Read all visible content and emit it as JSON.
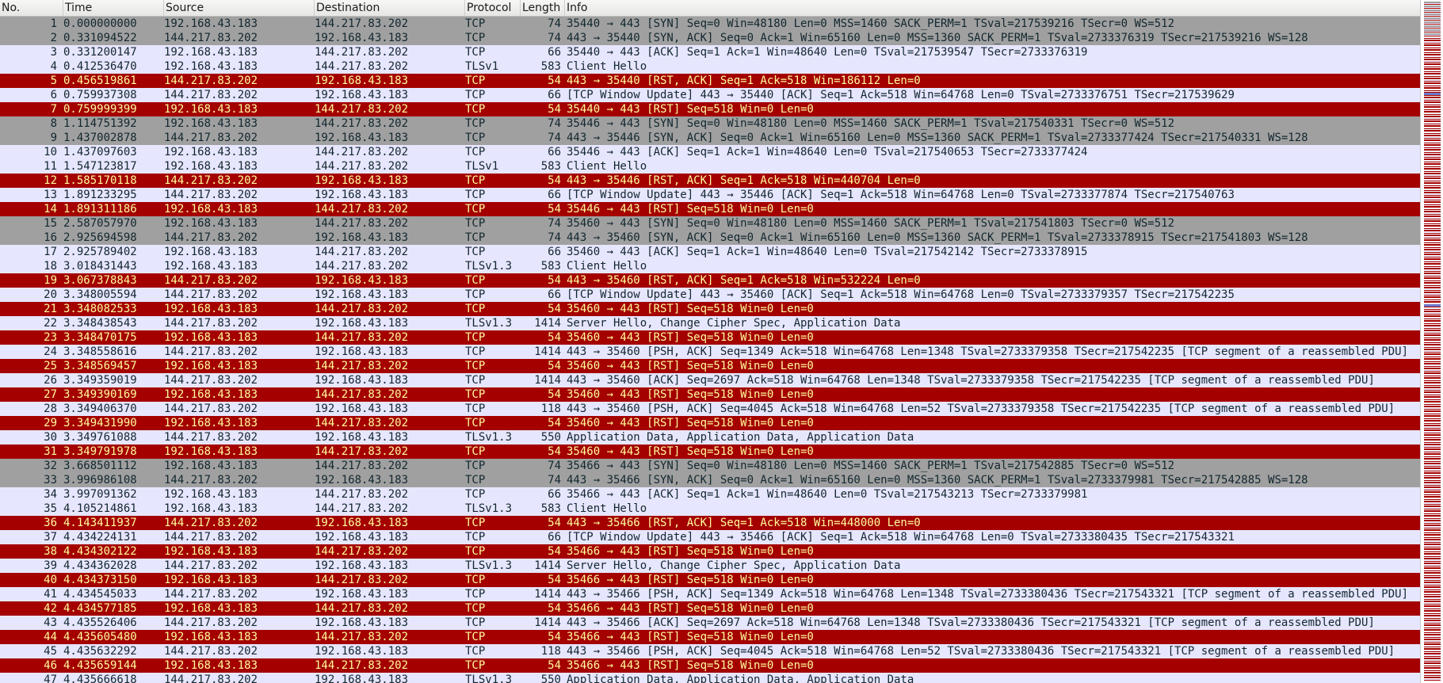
{
  "columns": {
    "no": "No.",
    "time": "Time",
    "source": "Source",
    "destination": "Destination",
    "protocol": "Protocol",
    "length": "Length",
    "info": "Info"
  },
  "colors": {
    "syn_bg": "#a0a0a0",
    "tcp_bg": "#e7e6ff",
    "rst_bg": "#a40000",
    "rst_fg": "#fffc9c",
    "text": "#12272e"
  },
  "packets": [
    {
      "no": "1",
      "time": "0.000000000",
      "src": "192.168.43.183",
      "dst": "144.217.83.202",
      "proto": "TCP",
      "len": "74",
      "info": "35440 → 443 [SYN] Seq=0 Win=48180 Len=0 MSS=1460 SACK_PERM=1 TSval=217539216 TSecr=0 WS=512",
      "color": "syn"
    },
    {
      "no": "2",
      "time": "0.331094522",
      "src": "144.217.83.202",
      "dst": "192.168.43.183",
      "proto": "TCP",
      "len": "74",
      "info": "443 → 35440 [SYN, ACK] Seq=0 Ack=1 Win=65160 Len=0 MSS=1360 SACK_PERM=1 TSval=2733376319 TSecr=217539216 WS=128",
      "color": "syn"
    },
    {
      "no": "3",
      "time": "0.331200147",
      "src": "192.168.43.183",
      "dst": "144.217.83.202",
      "proto": "TCP",
      "len": "66",
      "info": "35440 → 443 [ACK] Seq=1 Ack=1 Win=48640 Len=0 TSval=217539547 TSecr=2733376319",
      "color": "tcp"
    },
    {
      "no": "4",
      "time": "0.412536470",
      "src": "192.168.43.183",
      "dst": "144.217.83.202",
      "proto": "TLSv1",
      "len": "583",
      "info": "Client Hello",
      "color": "tcp"
    },
    {
      "no": "5",
      "time": "0.456519861",
      "src": "144.217.83.202",
      "dst": "192.168.43.183",
      "proto": "TCP",
      "len": "54",
      "info": "443 → 35440 [RST, ACK] Seq=1 Ack=518 Win=186112 Len=0",
      "color": "rst"
    },
    {
      "no": "6",
      "time": "0.759937308",
      "src": "144.217.83.202",
      "dst": "192.168.43.183",
      "proto": "TCP",
      "len": "66",
      "info": "[TCP Window Update] 443 → 35440 [ACK] Seq=1 Ack=518 Win=64768 Len=0 TSval=2733376751 TSecr=217539629",
      "color": "tcp"
    },
    {
      "no": "7",
      "time": "0.759999399",
      "src": "192.168.43.183",
      "dst": "144.217.83.202",
      "proto": "TCP",
      "len": "54",
      "info": "35440 → 443 [RST] Seq=518 Win=0 Len=0",
      "color": "rst"
    },
    {
      "no": "8",
      "time": "1.114751392",
      "src": "192.168.43.183",
      "dst": "144.217.83.202",
      "proto": "TCP",
      "len": "74",
      "info": "35446 → 443 [SYN] Seq=0 Win=48180 Len=0 MSS=1460 SACK_PERM=1 TSval=217540331 TSecr=0 WS=512",
      "color": "syn"
    },
    {
      "no": "9",
      "time": "1.437002878",
      "src": "144.217.83.202",
      "dst": "192.168.43.183",
      "proto": "TCP",
      "len": "74",
      "info": "443 → 35446 [SYN, ACK] Seq=0 Ack=1 Win=65160 Len=0 MSS=1360 SACK_PERM=1 TSval=2733377424 TSecr=217540331 WS=128",
      "color": "syn"
    },
    {
      "no": "10",
      "time": "1.437097603",
      "src": "192.168.43.183",
      "dst": "144.217.83.202",
      "proto": "TCP",
      "len": "66",
      "info": "35446 → 443 [ACK] Seq=1 Ack=1 Win=48640 Len=0 TSval=217540653 TSecr=2733377424",
      "color": "tcp"
    },
    {
      "no": "11",
      "time": "1.547123817",
      "src": "192.168.43.183",
      "dst": "144.217.83.202",
      "proto": "TLSv1",
      "len": "583",
      "info": "Client Hello",
      "color": "tcp"
    },
    {
      "no": "12",
      "time": "1.585170118",
      "src": "144.217.83.202",
      "dst": "192.168.43.183",
      "proto": "TCP",
      "len": "54",
      "info": "443 → 35446 [RST, ACK] Seq=1 Ack=518 Win=440704 Len=0",
      "color": "rst"
    },
    {
      "no": "13",
      "time": "1.891233295",
      "src": "144.217.83.202",
      "dst": "192.168.43.183",
      "proto": "TCP",
      "len": "66",
      "info": "[TCP Window Update] 443 → 35446 [ACK] Seq=1 Ack=518 Win=64768 Len=0 TSval=2733377874 TSecr=217540763",
      "color": "tcp"
    },
    {
      "no": "14",
      "time": "1.891311186",
      "src": "192.168.43.183",
      "dst": "144.217.83.202",
      "proto": "TCP",
      "len": "54",
      "info": "35446 → 443 [RST] Seq=518 Win=0 Len=0",
      "color": "rst"
    },
    {
      "no": "15",
      "time": "2.587057970",
      "src": "192.168.43.183",
      "dst": "144.217.83.202",
      "proto": "TCP",
      "len": "74",
      "info": "35460 → 443 [SYN] Seq=0 Win=48180 Len=0 MSS=1460 SACK_PERM=1 TSval=217541803 TSecr=0 WS=512",
      "color": "syn"
    },
    {
      "no": "16",
      "time": "2.925694598",
      "src": "144.217.83.202",
      "dst": "192.168.43.183",
      "proto": "TCP",
      "len": "74",
      "info": "443 → 35460 [SYN, ACK] Seq=0 Ack=1 Win=65160 Len=0 MSS=1360 SACK_PERM=1 TSval=2733378915 TSecr=217541803 WS=128",
      "color": "syn"
    },
    {
      "no": "17",
      "time": "2.925789402",
      "src": "192.168.43.183",
      "dst": "144.217.83.202",
      "proto": "TCP",
      "len": "66",
      "info": "35460 → 443 [ACK] Seq=1 Ack=1 Win=48640 Len=0 TSval=217542142 TSecr=2733378915",
      "color": "tcp"
    },
    {
      "no": "18",
      "time": "3.018431443",
      "src": "192.168.43.183",
      "dst": "144.217.83.202",
      "proto": "TLSv1.3",
      "len": "583",
      "info": "Client Hello",
      "color": "tcp"
    },
    {
      "no": "19",
      "time": "3.067378843",
      "src": "144.217.83.202",
      "dst": "192.168.43.183",
      "proto": "TCP",
      "len": "54",
      "info": "443 → 35460 [RST, ACK] Seq=1 Ack=518 Win=532224 Len=0",
      "color": "rst"
    },
    {
      "no": "20",
      "time": "3.348005594",
      "src": "144.217.83.202",
      "dst": "192.168.43.183",
      "proto": "TCP",
      "len": "66",
      "info": "[TCP Window Update] 443 → 35460 [ACK] Seq=1 Ack=518 Win=64768 Len=0 TSval=2733379357 TSecr=217542235",
      "color": "tcp"
    },
    {
      "no": "21",
      "time": "3.348082533",
      "src": "192.168.43.183",
      "dst": "144.217.83.202",
      "proto": "TCP",
      "len": "54",
      "info": "35460 → 443 [RST] Seq=518 Win=0 Len=0",
      "color": "rst"
    },
    {
      "no": "22",
      "time": "3.348438543",
      "src": "144.217.83.202",
      "dst": "192.168.43.183",
      "proto": "TLSv1.3",
      "len": "1414",
      "info": "Server Hello, Change Cipher Spec, Application Data",
      "color": "tcp"
    },
    {
      "no": "23",
      "time": "3.348470175",
      "src": "192.168.43.183",
      "dst": "144.217.83.202",
      "proto": "TCP",
      "len": "54",
      "info": "35460 → 443 [RST] Seq=518 Win=0 Len=0",
      "color": "rst"
    },
    {
      "no": "24",
      "time": "3.348558616",
      "src": "144.217.83.202",
      "dst": "192.168.43.183",
      "proto": "TCP",
      "len": "1414",
      "info": "443 → 35460 [PSH, ACK] Seq=1349 Ack=518 Win=64768 Len=1348 TSval=2733379358 TSecr=217542235 [TCP segment of a reassembled PDU]",
      "color": "tcp"
    },
    {
      "no": "25",
      "time": "3.348569457",
      "src": "192.168.43.183",
      "dst": "144.217.83.202",
      "proto": "TCP",
      "len": "54",
      "info": "35460 → 443 [RST] Seq=518 Win=0 Len=0",
      "color": "rst"
    },
    {
      "no": "26",
      "time": "3.349359019",
      "src": "144.217.83.202",
      "dst": "192.168.43.183",
      "proto": "TCP",
      "len": "1414",
      "info": "443 → 35460 [ACK] Seq=2697 Ack=518 Win=64768 Len=1348 TSval=2733379358 TSecr=217542235 [TCP segment of a reassembled PDU]",
      "color": "tcp"
    },
    {
      "no": "27",
      "time": "3.349390169",
      "src": "192.168.43.183",
      "dst": "144.217.83.202",
      "proto": "TCP",
      "len": "54",
      "info": "35460 → 443 [RST] Seq=518 Win=0 Len=0",
      "color": "rst"
    },
    {
      "no": "28",
      "time": "3.349406370",
      "src": "144.217.83.202",
      "dst": "192.168.43.183",
      "proto": "TCP",
      "len": "118",
      "info": "443 → 35460 [PSH, ACK] Seq=4045 Ack=518 Win=64768 Len=52 TSval=2733379358 TSecr=217542235 [TCP segment of a reassembled PDU]",
      "color": "tcp"
    },
    {
      "no": "29",
      "time": "3.349431990",
      "src": "192.168.43.183",
      "dst": "144.217.83.202",
      "proto": "TCP",
      "len": "54",
      "info": "35460 → 443 [RST] Seq=518 Win=0 Len=0",
      "color": "rst"
    },
    {
      "no": "30",
      "time": "3.349761088",
      "src": "144.217.83.202",
      "dst": "192.168.43.183",
      "proto": "TLSv1.3",
      "len": "550",
      "info": "Application Data, Application Data, Application Data",
      "color": "tcp"
    },
    {
      "no": "31",
      "time": "3.349791978",
      "src": "192.168.43.183",
      "dst": "144.217.83.202",
      "proto": "TCP",
      "len": "54",
      "info": "35460 → 443 [RST] Seq=518 Win=0 Len=0",
      "color": "rst"
    },
    {
      "no": "32",
      "time": "3.668501112",
      "src": "192.168.43.183",
      "dst": "144.217.83.202",
      "proto": "TCP",
      "len": "74",
      "info": "35466 → 443 [SYN] Seq=0 Win=48180 Len=0 MSS=1460 SACK_PERM=1 TSval=217542885 TSecr=0 WS=512",
      "color": "syn"
    },
    {
      "no": "33",
      "time": "3.996986108",
      "src": "144.217.83.202",
      "dst": "192.168.43.183",
      "proto": "TCP",
      "len": "74",
      "info": "443 → 35466 [SYN, ACK] Seq=0 Ack=1 Win=65160 Len=0 MSS=1360 SACK_PERM=1 TSval=2733379981 TSecr=217542885 WS=128",
      "color": "syn"
    },
    {
      "no": "34",
      "time": "3.997091362",
      "src": "192.168.43.183",
      "dst": "144.217.83.202",
      "proto": "TCP",
      "len": "66",
      "info": "35466 → 443 [ACK] Seq=1 Ack=1 Win=48640 Len=0 TSval=217543213 TSecr=2733379981",
      "color": "tcp"
    },
    {
      "no": "35",
      "time": "4.105214861",
      "src": "192.168.43.183",
      "dst": "144.217.83.202",
      "proto": "TLSv1.3",
      "len": "583",
      "info": "Client Hello",
      "color": "tcp"
    },
    {
      "no": "36",
      "time": "4.143411937",
      "src": "144.217.83.202",
      "dst": "192.168.43.183",
      "proto": "TCP",
      "len": "54",
      "info": "443 → 35466 [RST, ACK] Seq=1 Ack=518 Win=448000 Len=0",
      "color": "rst"
    },
    {
      "no": "37",
      "time": "4.434224131",
      "src": "144.217.83.202",
      "dst": "192.168.43.183",
      "proto": "TCP",
      "len": "66",
      "info": "[TCP Window Update] 443 → 35466 [ACK] Seq=1 Ack=518 Win=64768 Len=0 TSval=2733380435 TSecr=217543321",
      "color": "tcp"
    },
    {
      "no": "38",
      "time": "4.434302122",
      "src": "192.168.43.183",
      "dst": "144.217.83.202",
      "proto": "TCP",
      "len": "54",
      "info": "35466 → 443 [RST] Seq=518 Win=0 Len=0",
      "color": "rst"
    },
    {
      "no": "39",
      "time": "4.434362028",
      "src": "144.217.83.202",
      "dst": "192.168.43.183",
      "proto": "TLSv1.3",
      "len": "1414",
      "info": "Server Hello, Change Cipher Spec, Application Data",
      "color": "tcp"
    },
    {
      "no": "40",
      "time": "4.434373150",
      "src": "192.168.43.183",
      "dst": "144.217.83.202",
      "proto": "TCP",
      "len": "54",
      "info": "35466 → 443 [RST] Seq=518 Win=0 Len=0",
      "color": "rst"
    },
    {
      "no": "41",
      "time": "4.434545033",
      "src": "144.217.83.202",
      "dst": "192.168.43.183",
      "proto": "TCP",
      "len": "1414",
      "info": "443 → 35466 [PSH, ACK] Seq=1349 Ack=518 Win=64768 Len=1348 TSval=2733380436 TSecr=217543321 [TCP segment of a reassembled PDU]",
      "color": "tcp"
    },
    {
      "no": "42",
      "time": "4.434577185",
      "src": "192.168.43.183",
      "dst": "144.217.83.202",
      "proto": "TCP",
      "len": "54",
      "info": "35466 → 443 [RST] Seq=518 Win=0 Len=0",
      "color": "rst"
    },
    {
      "no": "43",
      "time": "4.435526406",
      "src": "144.217.83.202",
      "dst": "192.168.43.183",
      "proto": "TCP",
      "len": "1414",
      "info": "443 → 35466 [ACK] Seq=2697 Ack=518 Win=64768 Len=1348 TSval=2733380436 TSecr=217543321 [TCP segment of a reassembled PDU]",
      "color": "tcp"
    },
    {
      "no": "44",
      "time": "4.435605480",
      "src": "192.168.43.183",
      "dst": "144.217.83.202",
      "proto": "TCP",
      "len": "54",
      "info": "35466 → 443 [RST] Seq=518 Win=0 Len=0",
      "color": "rst"
    },
    {
      "no": "45",
      "time": "4.435632292",
      "src": "144.217.83.202",
      "dst": "192.168.43.183",
      "proto": "TCP",
      "len": "118",
      "info": "443 → 35466 [PSH, ACK] Seq=4045 Ack=518 Win=64768 Len=52 TSval=2733380436 TSecr=217543321 [TCP segment of a reassembled PDU]",
      "color": "tcp"
    },
    {
      "no": "46",
      "time": "4.435659144",
      "src": "192.168.43.183",
      "dst": "144.217.83.202",
      "proto": "TCP",
      "len": "54",
      "info": "35466 → 443 [RST] Seq=518 Win=0 Len=0",
      "color": "rst"
    },
    {
      "no": "47",
      "time": "4.435666618",
      "src": "144.217.83.202",
      "dst": "192.168.43.183",
      "proto": "TLSv1.3",
      "len": "550",
      "info": "Application Data, Application Data, Application Data",
      "color": "tcp"
    }
  ]
}
